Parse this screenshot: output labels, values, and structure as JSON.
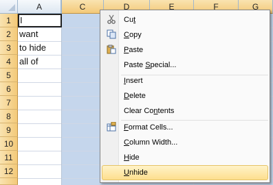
{
  "columns": [
    {
      "name": "A",
      "selected": false
    },
    {
      "name": "C",
      "selected": true
    },
    {
      "name": "D",
      "selected": true
    },
    {
      "name": "E",
      "selected": true
    },
    {
      "name": "F",
      "selected": true
    },
    {
      "name": "G",
      "selected": true
    }
  ],
  "rows": [
    "1",
    "2",
    "3",
    "4",
    "5",
    "6",
    "7",
    "8",
    "9",
    "10",
    "11",
    "12"
  ],
  "cells_colA": [
    "I",
    "want",
    "to hide",
    "all of",
    "",
    "",
    "",
    "",
    "",
    "",
    "",
    ""
  ],
  "active_cell": "A1",
  "colors": {
    "selection": "#c5d6ec",
    "header_selected": "#f3c979",
    "menu_hover": "#fddf8e"
  },
  "context_menu": {
    "items": [
      {
        "pre": "Cu",
        "acc": "t",
        "post": "",
        "icon": "scissors-icon"
      },
      {
        "pre": "",
        "acc": "C",
        "post": "opy",
        "icon": "copy-icon"
      },
      {
        "pre": "",
        "acc": "P",
        "post": "aste",
        "icon": "paste-icon"
      },
      {
        "pre": "Paste ",
        "acc": "S",
        "post": "pecial...",
        "icon": ""
      },
      {
        "pre": "",
        "acc": "I",
        "post": "nsert",
        "icon": ""
      },
      {
        "pre": "",
        "acc": "D",
        "post": "elete",
        "icon": ""
      },
      {
        "pre": "Clear Co",
        "acc": "n",
        "post": "tents",
        "icon": ""
      },
      {
        "pre": "",
        "acc": "F",
        "post": "ormat Cells...",
        "icon": "format-cells-icon"
      },
      {
        "pre": "",
        "acc": "C",
        "post": "olumn Width...",
        "icon": ""
      },
      {
        "pre": "",
        "acc": "H",
        "post": "ide",
        "icon": ""
      },
      {
        "pre": "",
        "acc": "U",
        "post": "nhide",
        "icon": ""
      }
    ],
    "hovered_item": "Unhide"
  }
}
